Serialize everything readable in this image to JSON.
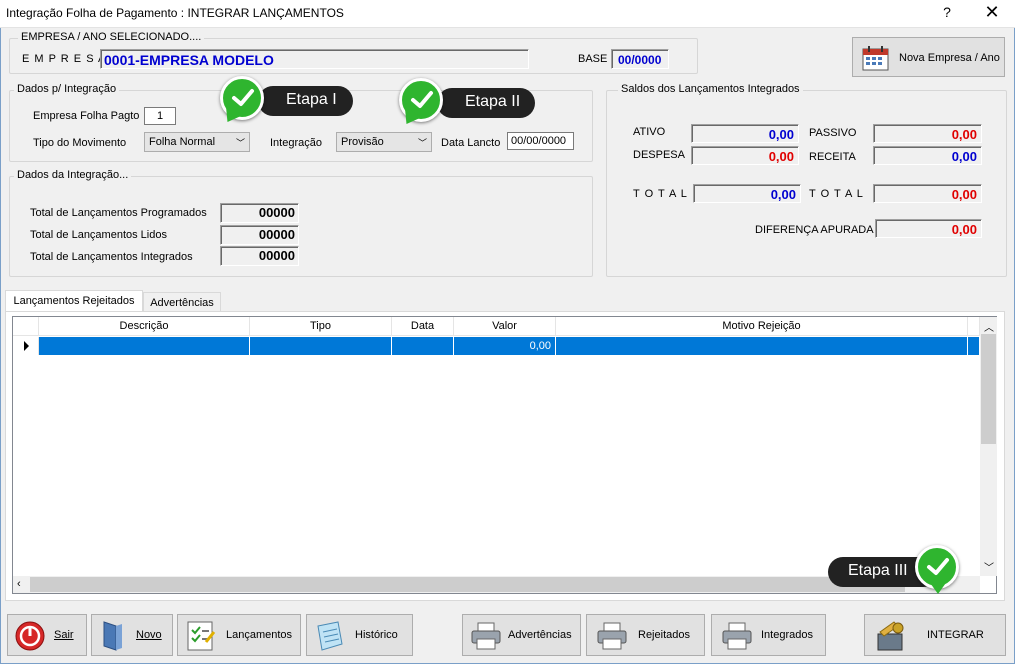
{
  "window": {
    "title": "Integração Folha de Pagamento : INTEGRAR LANÇAMENTOS",
    "help": "?",
    "close": "✕"
  },
  "empresa_group": {
    "legend": "EMPRESA  /  ANO  SELECIONADO....",
    "label": "E M P R E S A",
    "value": "0001-EMPRESA MODELO",
    "base_label": "BASE",
    "base_value": "00/0000"
  },
  "nova_empresa_button": {
    "label": "Nova Empresa / Ano",
    "icon": "calendar-icon"
  },
  "dados_integracao_params": {
    "legend": "Dados p/ Integração",
    "empresa_folha_label": "Empresa Folha Pagto",
    "empresa_folha_value": "1",
    "tipo_movimento_label": "Tipo do Movimento",
    "tipo_movimento_value": "Folha Normal",
    "integracao_label": "Integração",
    "integracao_value": "Provisão",
    "data_lancto_label": "Data Lancto",
    "data_lancto_value": "00/00/0000"
  },
  "callouts": {
    "etapa1": "Etapa I",
    "etapa2": "Etapa II",
    "etapa3": "Etapa III"
  },
  "dados_integracao": {
    "legend": "Dados da Integração...",
    "programados_label": "Total de Lançamentos Programados",
    "programados_value": "00000",
    "lidos_label": "Total de Lançamentos Lidos",
    "lidos_value": "00000",
    "integrados_label": "Total de Lançamentos Integrados",
    "integrados_value": "00000"
  },
  "saldos": {
    "legend": "Saldos dos Lançamentos Integrados",
    "ativo_label": "ATIVO",
    "ativo_value": "0,00",
    "passivo_label": "PASSIVO",
    "passivo_value": "0,00",
    "despesa_label": "DESPESA",
    "despesa_value": "0,00",
    "receita_label": "RECEITA",
    "receita_value": "0,00",
    "total1_label": "T O T A L",
    "total1_value": "0,00",
    "total2_label": "T O T A L",
    "total2_value": "0,00",
    "diferenca_label": "DIFERENÇA APURADA",
    "diferenca_value": "0,00"
  },
  "tabs": [
    {
      "label": "Lançamentos Rejeitados"
    },
    {
      "label": "Advertências"
    }
  ],
  "grid": {
    "columns": [
      "Descrição",
      "Tipo",
      "Data",
      "Valor",
      "Motivo Rejeição"
    ],
    "rows": [
      {
        "descricao": "",
        "tipo": "",
        "data": "",
        "valor": "0,00",
        "motivo": ""
      }
    ]
  },
  "buttons": {
    "sair": "Sair",
    "novo": "Novo",
    "lancamentos": "Lançamentos",
    "historico": "Histórico",
    "advertencias": "Advertências",
    "rejeitados": "Rejeitados",
    "integrados": "Integrados",
    "integrar": "INTEGRAR"
  },
  "colors": {
    "accent_blue": "#0000d0",
    "negative_red": "#e00000",
    "selection": "#0078d7",
    "callout_green": "#2fb52f"
  }
}
